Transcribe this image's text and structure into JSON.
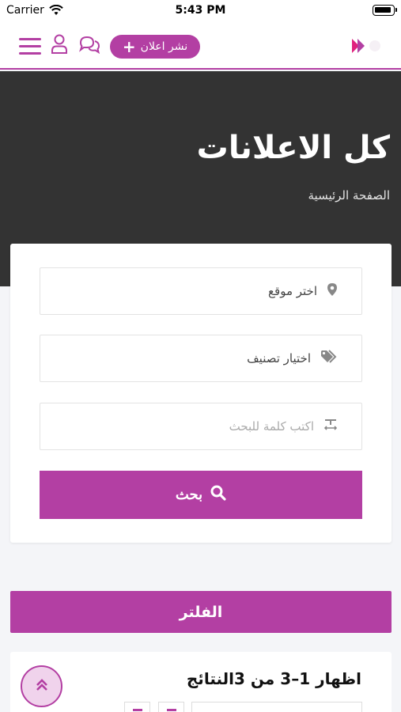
{
  "status_bar": {
    "carrier": "Carrier",
    "time": "5:43 PM"
  },
  "navbar": {
    "post_ad_label": "نشر اعلان",
    "icons": [
      "menu-icon",
      "user-icon",
      "chat-icon",
      "plus-icon",
      "logo-icon"
    ]
  },
  "hero": {
    "title": "كل الاعلانات",
    "breadcrumb": "الصفحة الرئيسية"
  },
  "search": {
    "location_label": "اختر موقع",
    "category_label": "اختيار تصنيف",
    "keyword_placeholder": "اكتب كلمة للبحث",
    "button_label": "بحث"
  },
  "filter": {
    "label": "الفلتر"
  },
  "results": {
    "summary": "اظهار 1–3 من 3النتائج"
  },
  "colors": {
    "accent": "#b33fa3",
    "hero_bg": "#333333",
    "page_bg": "#f4f5f8"
  }
}
